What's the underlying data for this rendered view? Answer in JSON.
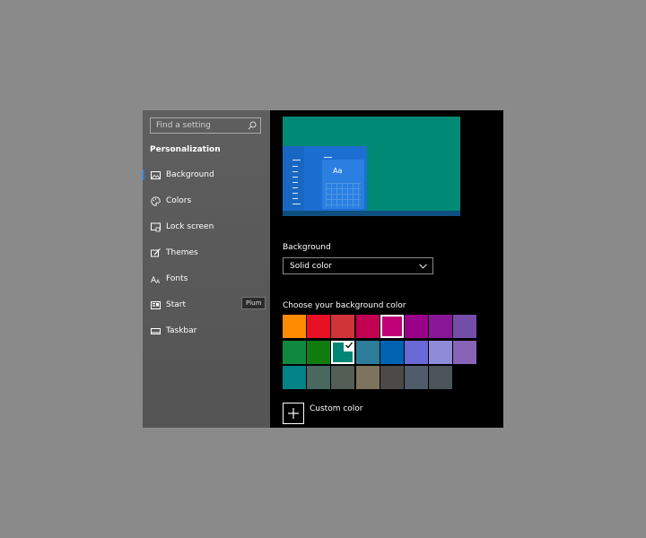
{
  "sidebar": {
    "search_placeholder": "Find a setting",
    "section_title": "Personalization",
    "items": [
      {
        "label": "Background",
        "icon": "picture-icon"
      },
      {
        "label": "Colors",
        "icon": "palette-icon"
      },
      {
        "label": "Lock screen",
        "icon": "lock-screen-icon"
      },
      {
        "label": "Themes",
        "icon": "brush-icon"
      },
      {
        "label": "Fonts",
        "icon": "font-icon"
      },
      {
        "label": "Start",
        "icon": "start-icon"
      },
      {
        "label": "Taskbar",
        "icon": "taskbar-icon"
      }
    ],
    "selected_item": "Background",
    "accent_color": "#2a7fd4"
  },
  "preview": {
    "tile_text": "Aa",
    "background_color": "#008a75"
  },
  "background": {
    "label": "Background",
    "selected_value": "Solid color"
  },
  "colors": {
    "label": "Choose your background color",
    "tooltip": "Plum",
    "swatches": [
      [
        "#ff8c00",
        "#e81123",
        "#d13438",
        "#c30052",
        "#bf0077",
        "#9a0089",
        "#881798",
        "#744da9"
      ],
      [
        "#10893e",
        "#107c10",
        "#018574",
        "#2d7d9a",
        "#0063b1",
        "#6b69d6",
        "#8e8cd8",
        "#8764b8"
      ],
      [
        "#038387",
        "#486860",
        "#525e54",
        "#7e735f",
        "#4c4a48",
        "#515c6b",
        "#4a5459"
      ]
    ],
    "selected": [
      1,
      2
    ],
    "hovered": [
      0,
      4
    ],
    "custom_label": "Custom color"
  }
}
